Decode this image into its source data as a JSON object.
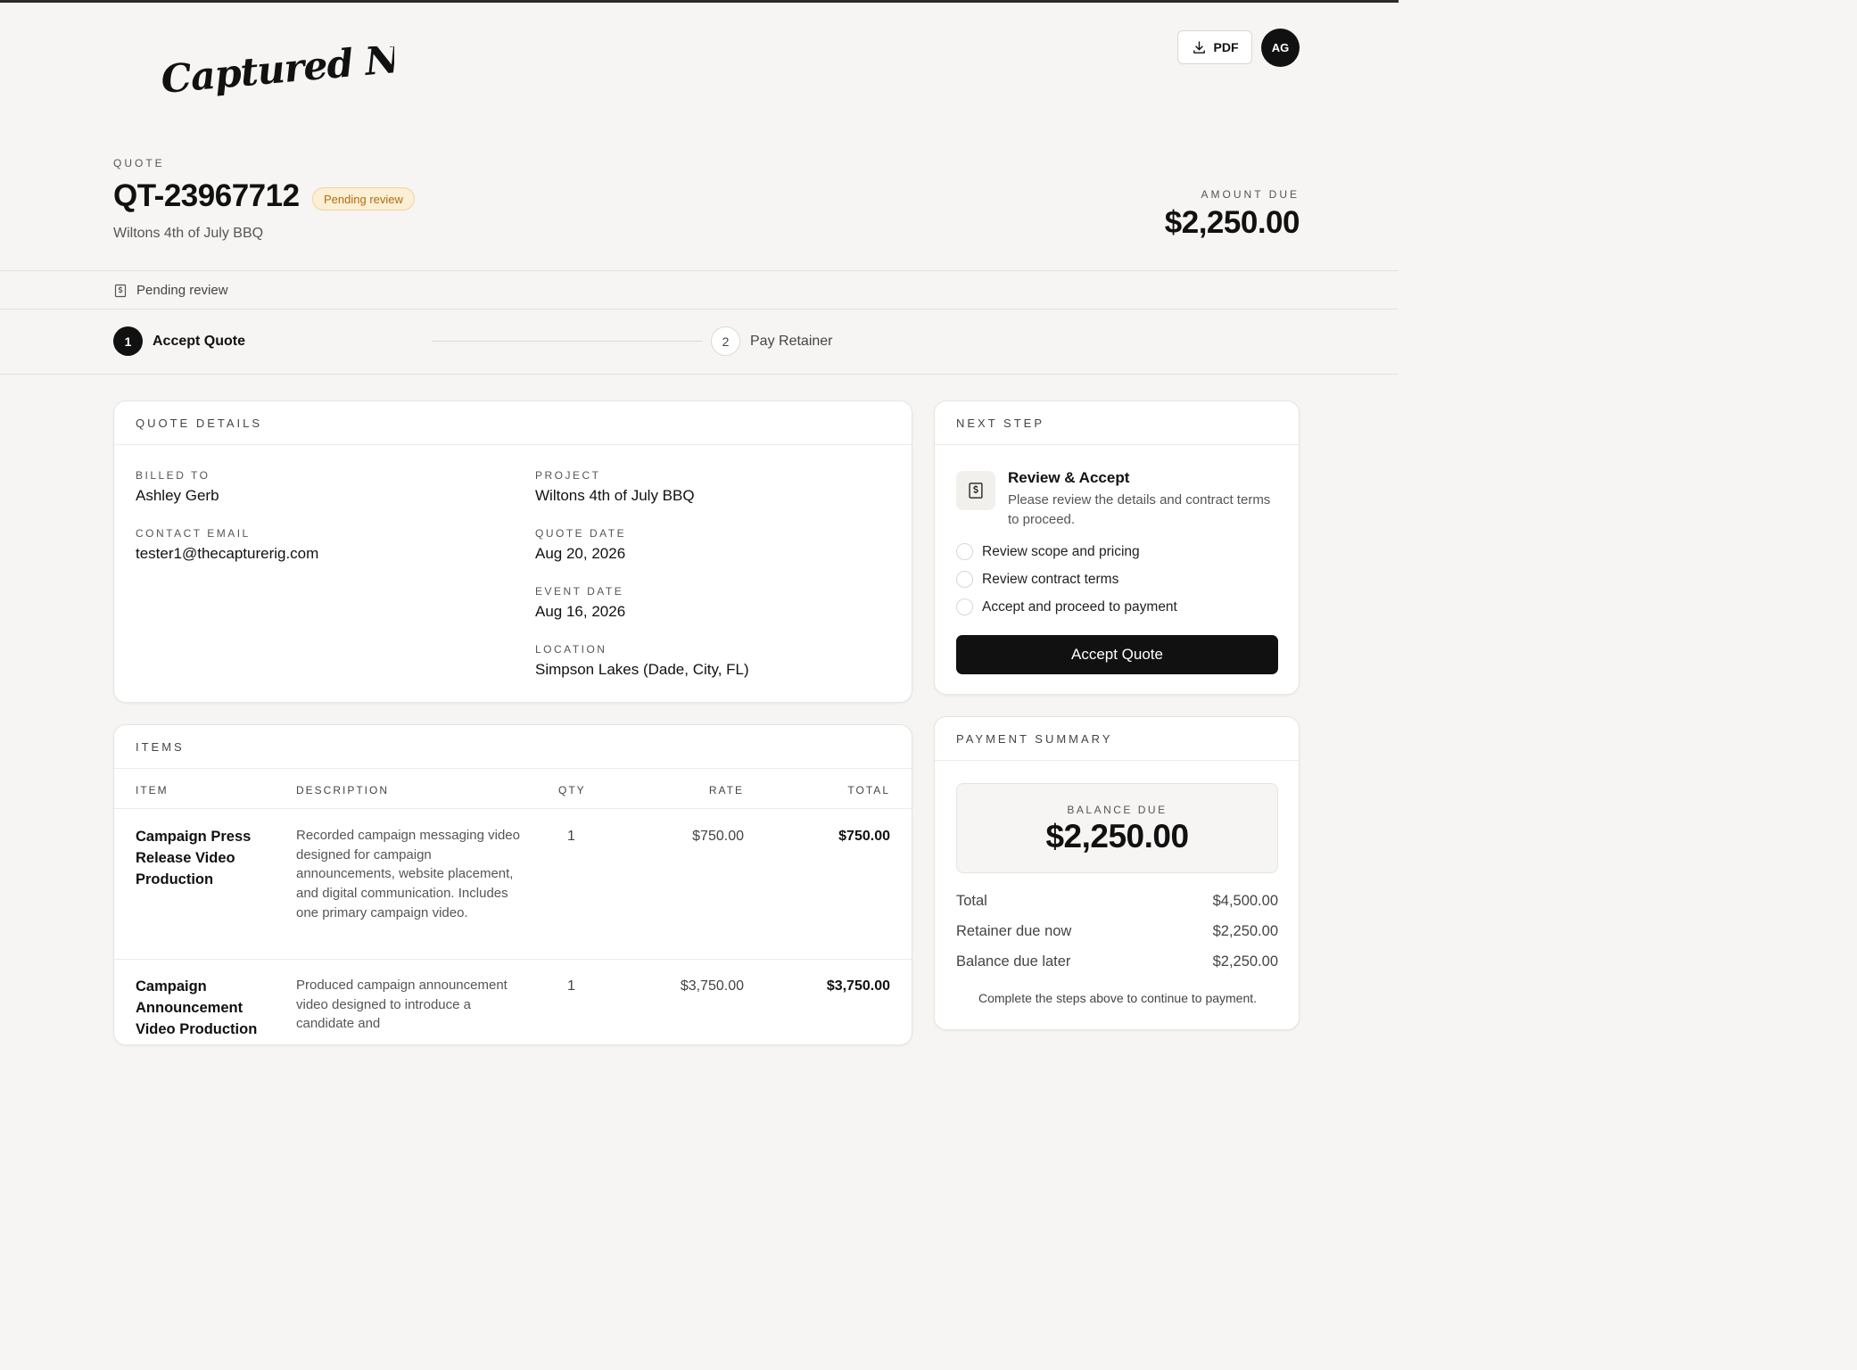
{
  "brand": {
    "logo_text": "Captured Now"
  },
  "header": {
    "pdf_label": "PDF",
    "avatar_initials": "AG"
  },
  "quote": {
    "doc_type": "QUOTE",
    "number": "QT-23967712",
    "status_badge": "Pending review",
    "project_subtitle": "Wiltons 4th of July BBQ",
    "amount_due_label": "AMOUNT DUE",
    "amount_due": "$2,250.00"
  },
  "status_strip": {
    "text": "Pending review"
  },
  "steps": [
    {
      "number": "1",
      "label": "Accept Quote",
      "active": true
    },
    {
      "number": "2",
      "label": "Pay Retainer",
      "active": false
    }
  ],
  "details": {
    "heading": "QUOTE DETAILS",
    "billed_to_label": "BILLED TO",
    "billed_to": "Ashley Gerb",
    "email_label": "CONTACT EMAIL",
    "email": "tester1@thecapturerig.com",
    "project_label": "PROJECT",
    "project": "Wiltons 4th of July BBQ",
    "quote_date_label": "QUOTE DATE",
    "quote_date": "Aug 20, 2026",
    "event_date_label": "EVENT DATE",
    "event_date": "Aug 16, 2026",
    "location_label": "LOCATION",
    "location": "Simpson Lakes (Dade, City, FL)"
  },
  "next_step": {
    "heading": "NEXT STEP",
    "title": "Review & Accept",
    "description": "Please review the details and contract terms to proceed.",
    "checklist": [
      "Review scope and pricing",
      "Review contract terms",
      "Accept and proceed to payment"
    ],
    "button_label": "Accept Quote"
  },
  "items": {
    "heading": "ITEMS",
    "columns": [
      "ITEM",
      "DESCRIPTION",
      "QTY",
      "RATE",
      "TOTAL"
    ],
    "rows": [
      {
        "item": "Campaign Press Release Video Production",
        "description": "Recorded campaign messaging video designed for campaign announcements, website placement, and digital communication. Includes one primary campaign video.",
        "qty": "1",
        "rate": "$750.00",
        "total": "$750.00"
      },
      {
        "item": "Campaign Announcement Video Production",
        "description": "Produced campaign announcement video designed to introduce a candidate and",
        "qty": "1",
        "rate": "$3,750.00",
        "total": "$3,750.00"
      }
    ]
  },
  "payment_summary": {
    "heading": "PAYMENT SUMMARY",
    "balance_label": "BALANCE DUE",
    "balance_value": "$2,250.00",
    "rows": [
      {
        "label": "Total",
        "value": "$4,500.00"
      },
      {
        "label": "Retainer due now",
        "value": "$2,250.00"
      },
      {
        "label": "Balance due later",
        "value": "$2,250.00"
      }
    ],
    "note": "Complete the steps above to continue to payment."
  }
}
